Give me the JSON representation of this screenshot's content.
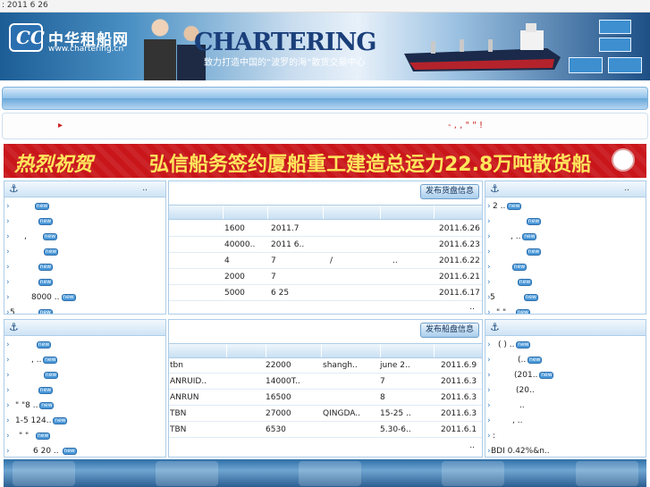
{
  "topbar": {
    "date": ": 2011 6 26"
  },
  "header": {
    "logo_cn": "中华租船网",
    "logo_url": "www.chartering.cn",
    "brand": "CHARTERING",
    "slogan": "致力打造中国的“波罗的海”散货交易中心"
  },
  "marquee": {
    "left": "▸",
    "right": "-    ,     ,    \"  \"   !"
  },
  "ad": {
    "prefix": "热烈祝贺",
    "text": "弘信船务签约厦船重工建造总运力22.8万吨散货船"
  },
  "left_top": {
    "more": "..",
    "items": [
      {
        "text": "",
        "new": true
      },
      {
        "text": "",
        "new": true
      },
      {
        "text": ",",
        "new": true
      },
      {
        "text": "",
        "new": true
      },
      {
        "text": "",
        "new": true
      },
      {
        "text": "",
        "new": true
      },
      {
        "text": "8000 ..",
        "new": true
      },
      {
        "text": "5",
        "new": true
      }
    ]
  },
  "left_bottom": {
    "items": [
      {
        "text": "",
        "new": true
      },
      {
        "text": ",   ..",
        "new": true
      },
      {
        "text": "",
        "new": true
      },
      {
        "text": "",
        "new": true
      },
      {
        "text": "\"   \"8 ..",
        "new": true
      },
      {
        "text": "1-5       124..",
        "new": true
      },
      {
        "text": "\" \"",
        "new": true
      },
      {
        "text": "6 20 ..",
        "new": true
      }
    ]
  },
  "cargo_table": {
    "publish_label": "发布货盘信息",
    "rows": [
      [
        "",
        "1600",
        "2011.7",
        "",
        "",
        "2011.6.26"
      ],
      [
        "",
        "40000..",
        "2011 6..",
        "",
        "",
        "2011.6.23"
      ],
      [
        "",
        "4",
        "7",
        "/",
        "..",
        "2011.6.22"
      ],
      [
        "",
        "2000",
        "7",
        "",
        "",
        "2011.6.21"
      ],
      [
        "",
        "5000",
        "6 25",
        "",
        "",
        "2011.6.17"
      ]
    ],
    "more": ".."
  },
  "ship_table": {
    "publish_label": "发布船盘信息",
    "rows": [
      [
        "tbn",
        "22000",
        "shangh..",
        "june 2..",
        "2011.6.9"
      ],
      [
        "ANRUID..",
        "14000T..",
        "",
        "7",
        "2011.6.3"
      ],
      [
        "ANRUN",
        "16500",
        "",
        "8",
        "2011.6.3"
      ],
      [
        "TBN",
        "27000",
        "QINGDA..",
        "15-25 ..",
        "2011.6.3"
      ],
      [
        "TBN",
        "6530",
        "",
        "5.30-6..",
        "2011.6.1"
      ]
    ],
    "more": ".."
  },
  "right_top": {
    "more": "..",
    "items": [
      {
        "text": "2            ..",
        "new": true
      },
      {
        "text": "",
        "new": true
      },
      {
        "text": ",   ..",
        "new": true
      },
      {
        "text": "",
        "new": true
      },
      {
        "text": "",
        "new": true
      },
      {
        "text": "",
        "new": true
      },
      {
        "text": "5",
        "new": true
      },
      {
        "text": "\"   \"   ..",
        "new": true
      }
    ]
  },
  "right_bottom": {
    "items": [
      {
        "text": "(  )        ..",
        "new": true
      },
      {
        "text": "(..",
        "new": true
      },
      {
        "text": "(201..",
        "new": true
      },
      {
        "text": "(20..",
        "new": false
      },
      {
        "text": "..",
        "new": false
      },
      {
        "text": ",  ..",
        "new": false
      },
      {
        "text": ":",
        "new": false
      },
      {
        "text": "BDI    0.42%&n..",
        "new": false
      }
    ]
  },
  "icons": {
    "anchor": "anchor-icon",
    "arrow": "arrow-right-icon",
    "new_badge": "new-badge-icon"
  },
  "colors": {
    "brand_blue": "#1d4f86",
    "ad_red": "#c9161b",
    "ad_text": "#ffe65c",
    "new_badge": "#4a98d8"
  }
}
